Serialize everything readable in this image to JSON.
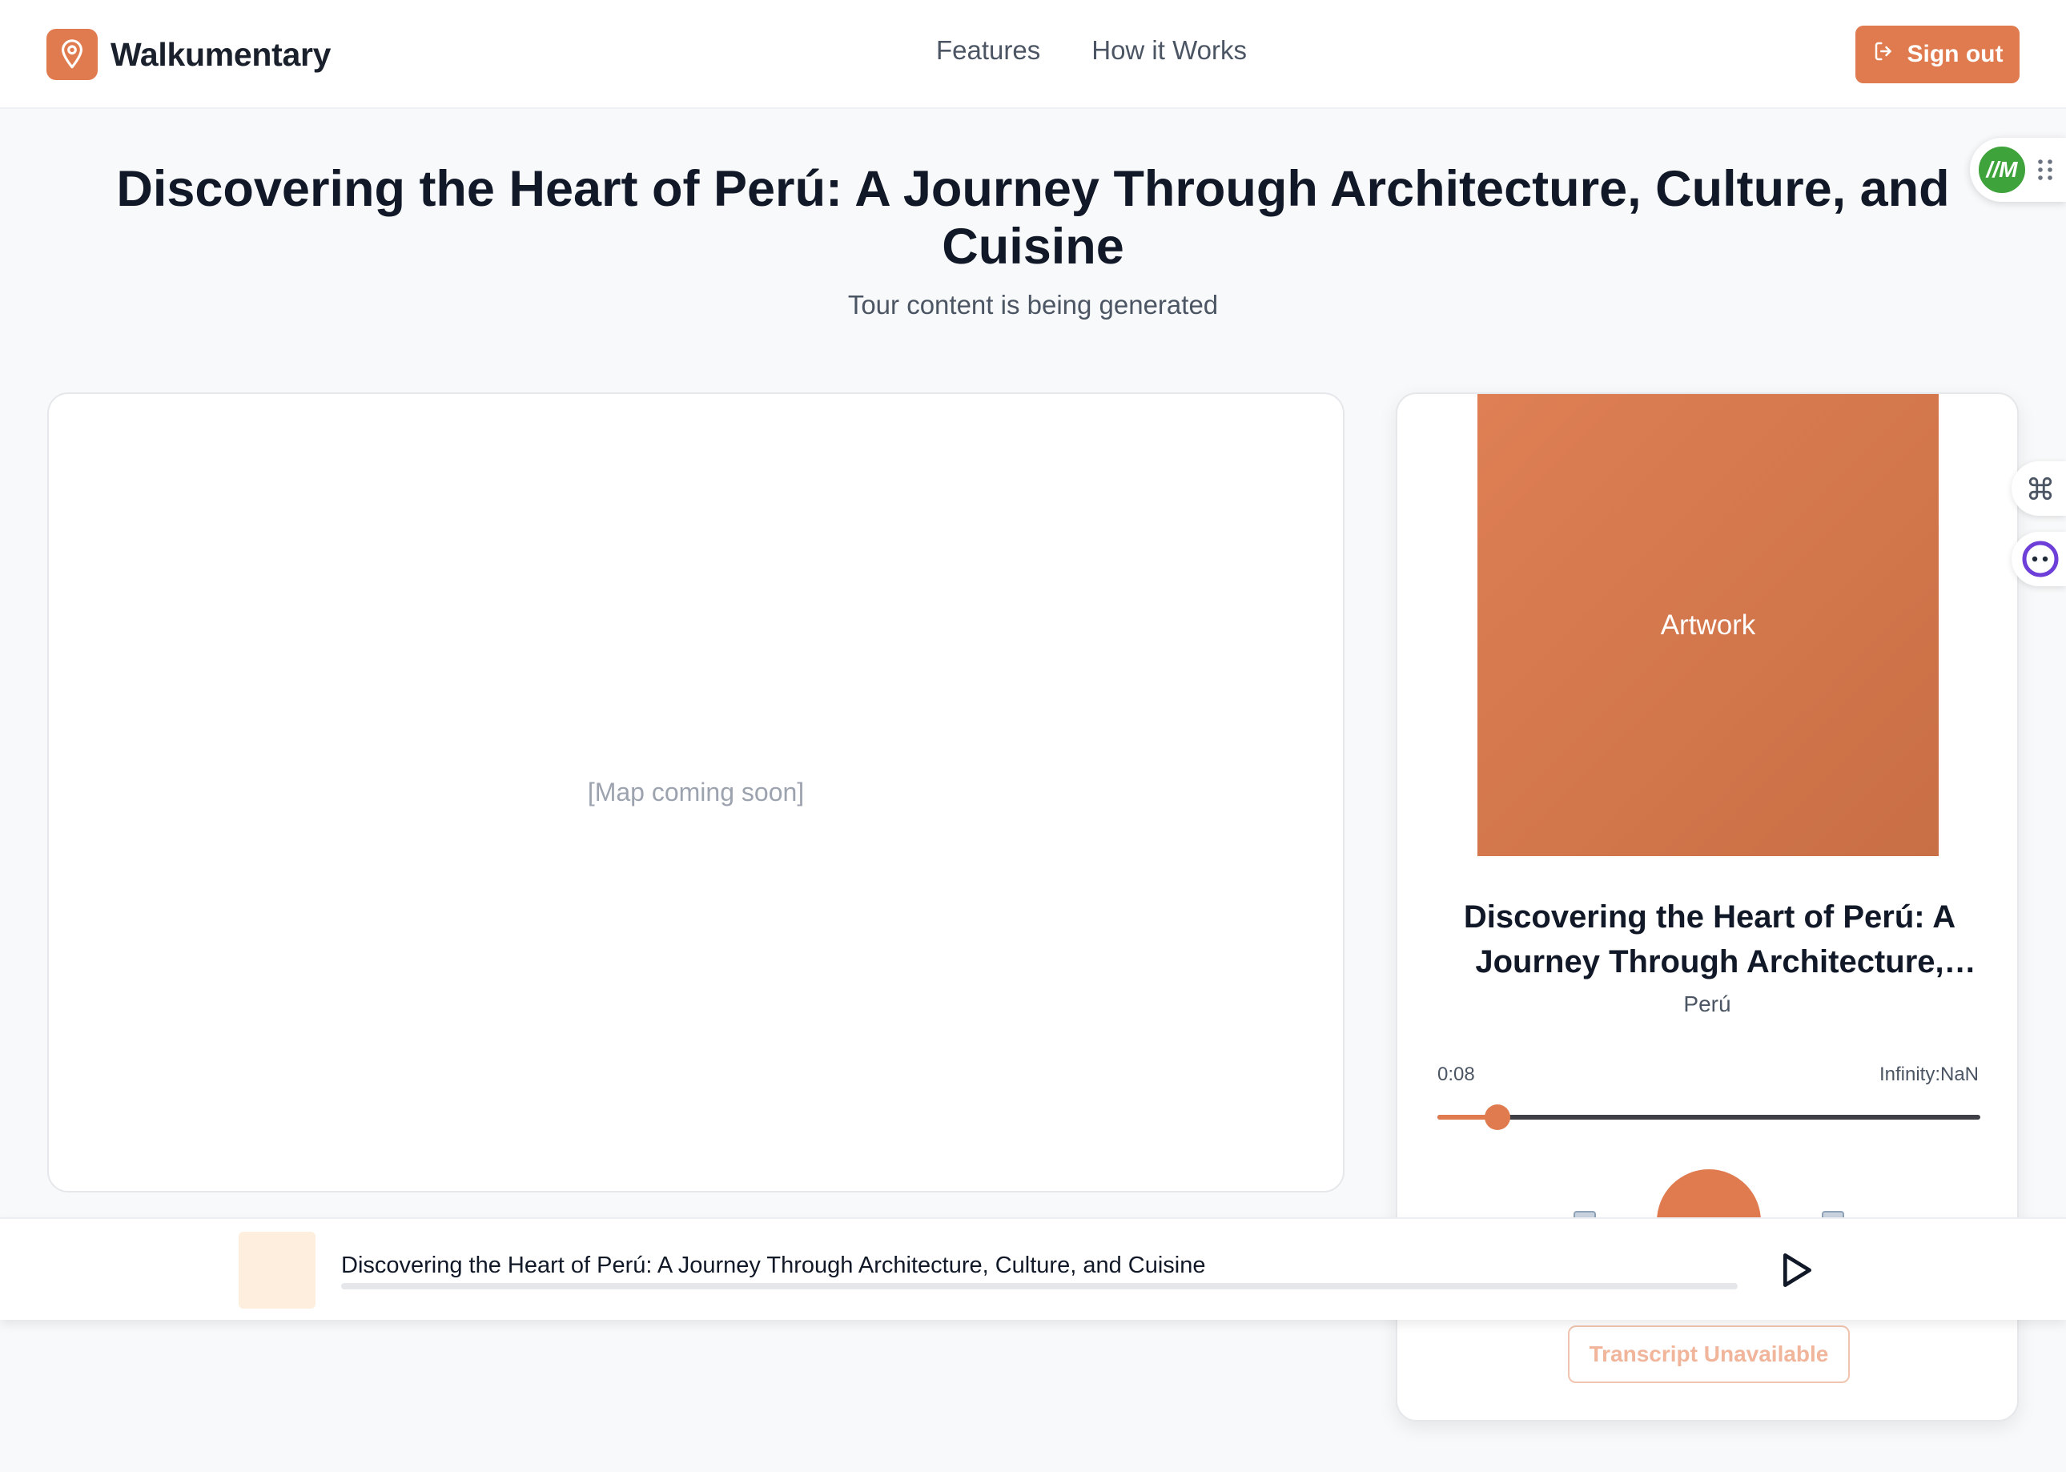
{
  "brand": {
    "name": "Walkumentary",
    "logo_icon": "map-pin-icon",
    "accent_color": "#e07b4f"
  },
  "nav": {
    "items": [
      {
        "label": "Features"
      },
      {
        "label": "How it Works"
      }
    ]
  },
  "header": {
    "signout_label": "Sign out",
    "signout_icon": "sign-out-icon"
  },
  "page": {
    "title": "Discovering the Heart of Perú: A Journey Through Architecture, Culture, and Cuisine",
    "subtitle": "Tour content is being generated"
  },
  "map": {
    "placeholder": "[Map coming soon]"
  },
  "player": {
    "artwork_label": "Artwork",
    "title": "Discovering the Heart of Perú: A Journey Through Architecture, Culture, and Cuisine",
    "location": "Perú",
    "time_current": "0:08",
    "time_total": "Infinity:NaN",
    "progress_fraction": 0.11,
    "transcript_label": "Transcript Unavailable"
  },
  "mini_player": {
    "title": "Discovering the Heart of Perú: A Journey Through Architecture, Culture, and Cuisine",
    "play_icon": "play-icon"
  },
  "widgets": {
    "avatar_initials": "//M"
  }
}
